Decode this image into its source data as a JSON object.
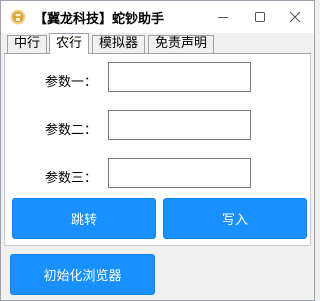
{
  "window": {
    "title": "【冀龙科技】蛇钞助手"
  },
  "tabs": [
    {
      "label": "中行"
    },
    {
      "label": "农行"
    },
    {
      "label": "模拟器"
    },
    {
      "label": "免责声明"
    }
  ],
  "form": {
    "param1": {
      "label": "参数一：",
      "value": ""
    },
    "param2": {
      "label": "参数二：",
      "value": ""
    },
    "param3": {
      "label": "参数三：",
      "value": ""
    }
  },
  "buttons": {
    "jump": "跳转",
    "write": "写入",
    "init_browser": "初始化浏览器"
  },
  "colors": {
    "accent": "#1890ff"
  }
}
